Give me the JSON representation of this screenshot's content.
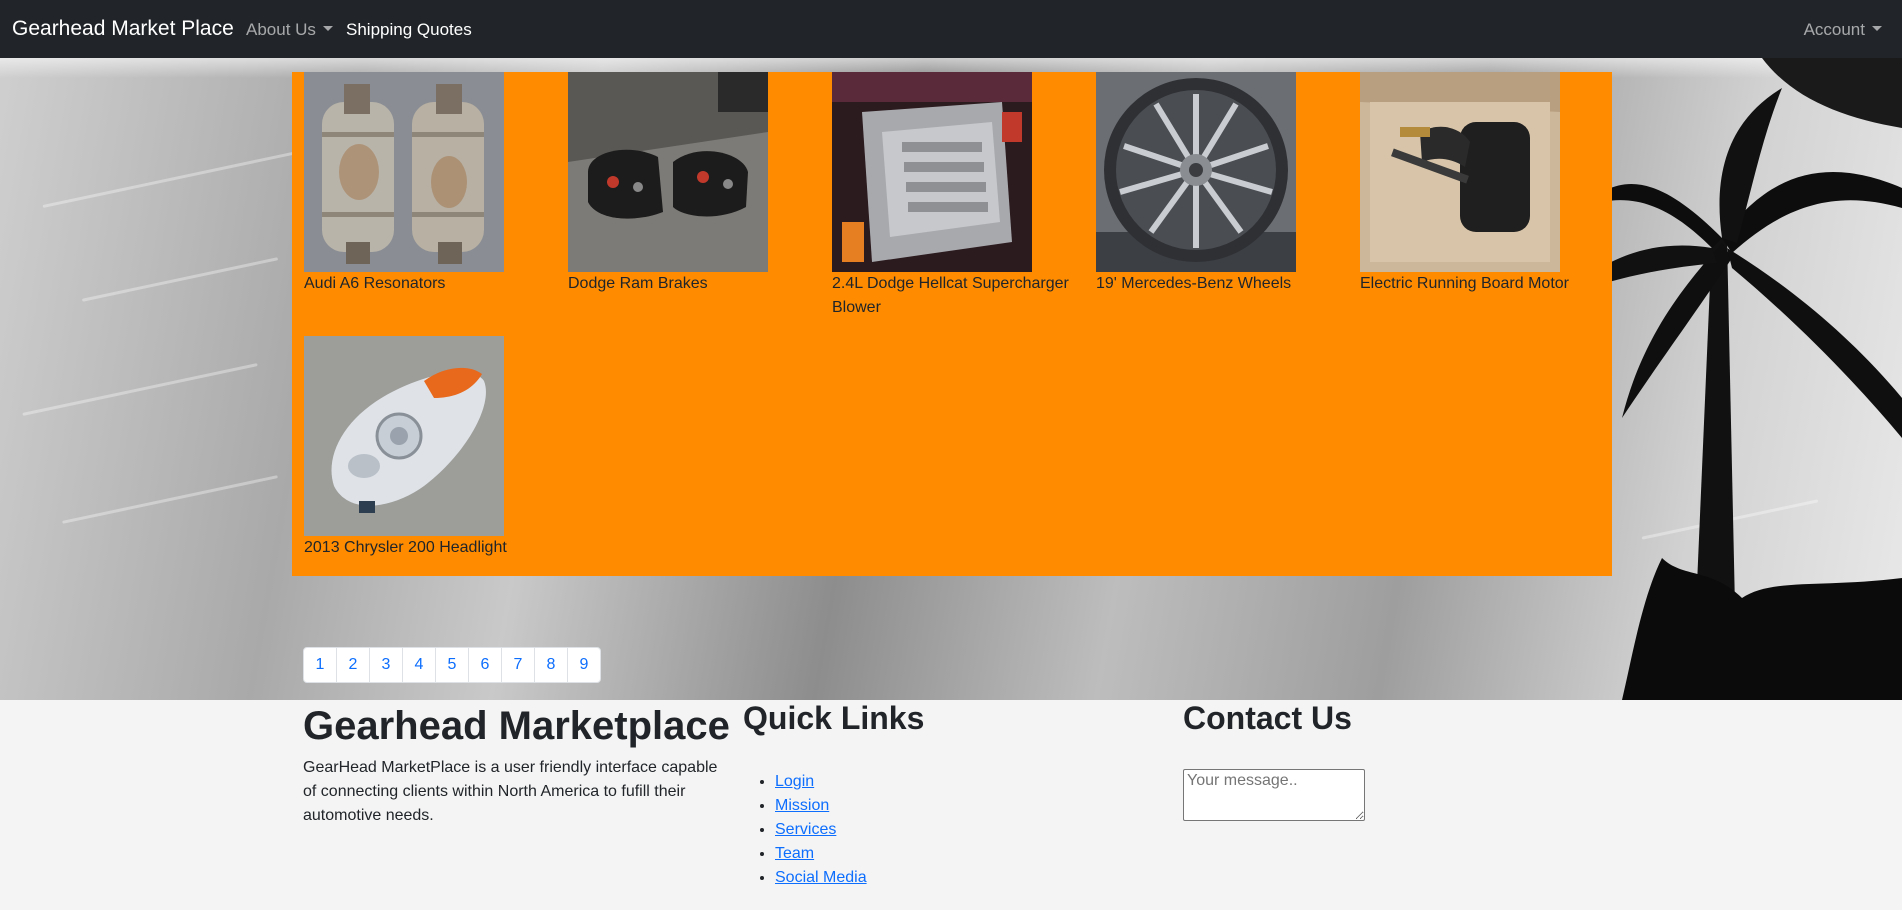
{
  "navbar": {
    "brand": "Gearhead Market Place",
    "about_label": "About Us",
    "shipping_label": "Shipping Quotes",
    "account_label": "Account"
  },
  "products": [
    {
      "name": "Audi A6 Resonators",
      "image": "resonators"
    },
    {
      "name": "Dodge Ram Brakes",
      "image": "brakes"
    },
    {
      "name": "2.4L Dodge Hellcat Supercharger Blower",
      "image": "supercharger"
    },
    {
      "name": "19' Mercedes-Benz Wheels",
      "image": "wheel"
    },
    {
      "name": "Electric Running Board Motor",
      "image": "motor"
    },
    {
      "name": "2013 Chrysler 200 Headlight",
      "image": "headlight"
    }
  ],
  "pagination": [
    "1",
    "2",
    "3",
    "4",
    "5",
    "6",
    "7",
    "8",
    "9"
  ],
  "footer": {
    "title": "Gearhead Marketplace",
    "description": "GearHead MarketPlace is a user friendly interface capable of connecting clients within North America to fufill their automotive needs.",
    "quick_links_title": "Quick Links",
    "quick_links": [
      "Login",
      "Mission",
      "Services",
      "Team",
      "Social Media"
    ],
    "contact_title": "Contact Us",
    "message_placeholder": "Your message.."
  },
  "colors": {
    "navbar_bg": "#212529",
    "panel_bg": "#ff8c00",
    "link": "#0d6efd",
    "footer_bg": "#f4f4f4"
  }
}
